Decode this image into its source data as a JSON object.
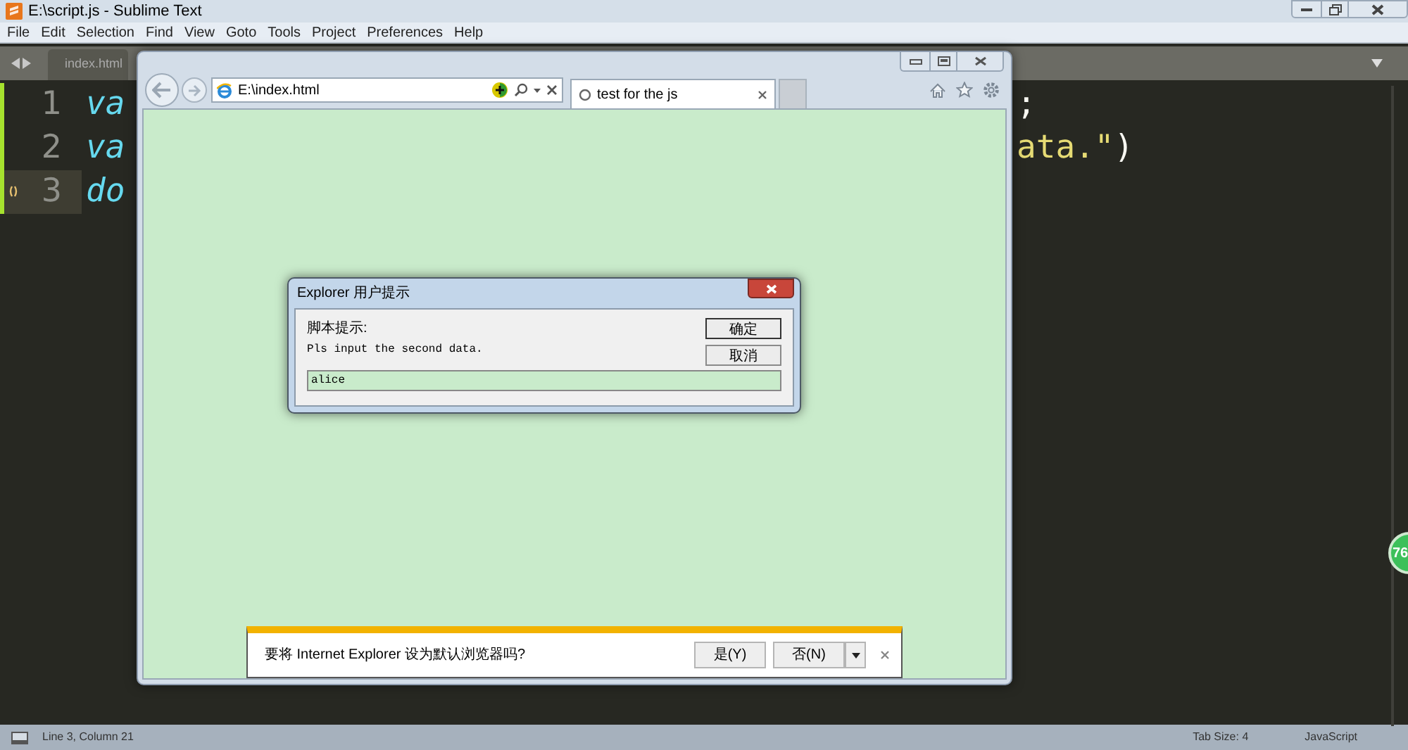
{
  "editor_window": {
    "title": "E:\\script.js - Sublime Text",
    "menu": [
      "File",
      "Edit",
      "Selection",
      "Find",
      "View",
      "Goto",
      "Tools",
      "Project",
      "Preferences",
      "Help"
    ],
    "tab": {
      "label": "index.html"
    },
    "code_lines": [
      {
        "number": "1",
        "current": false,
        "left": [
          {
            "text": "va",
            "kind": "keyword"
          }
        ],
        "right": [
          {
            "text": ";",
            "kind": "punct"
          }
        ]
      },
      {
        "number": "2",
        "current": false,
        "left": [
          {
            "text": "va",
            "kind": "keyword"
          }
        ],
        "right": [
          {
            "text": "ata.\"",
            "kind": "string"
          },
          {
            "text": ")",
            "kind": "punct"
          }
        ]
      },
      {
        "number": "3",
        "current": true,
        "left": [
          {
            "text": "do",
            "kind": "keyword"
          }
        ]
      }
    ],
    "side_badge": "76",
    "status_bar": {
      "position": "Line 3, Column 21",
      "tab_size": "Tab Size: 4",
      "syntax": "JavaScript"
    }
  },
  "browser": {
    "address": "E:\\index.html",
    "tab": {
      "label": "test for the js"
    }
  },
  "prompt_dialog": {
    "title": "Explorer 用户提示",
    "heading": "脚本提示:",
    "message": "Pls input the second data.",
    "value": "alice",
    "buttons": [
      "确定",
      "取消"
    ]
  },
  "notification_bar": {
    "message": "要将 Internet Explorer 设为默认浏览器吗?",
    "buttons": [
      "是(Y)",
      "否(N)"
    ]
  }
}
